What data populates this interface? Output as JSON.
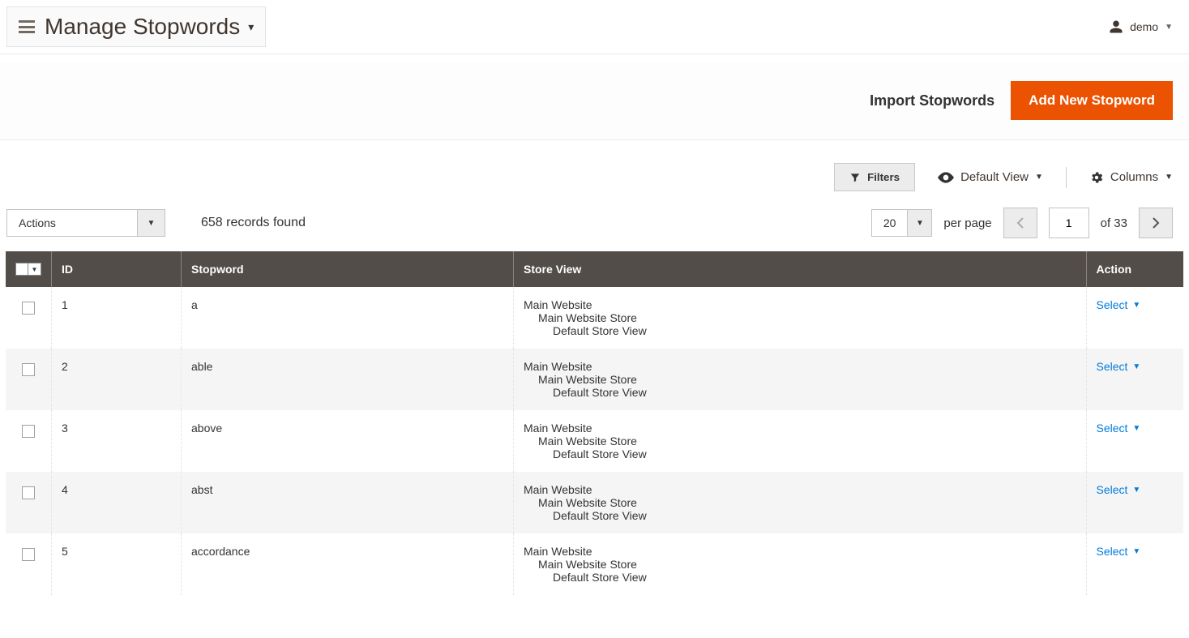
{
  "header": {
    "title": "Manage Stopwords",
    "user_label": "demo"
  },
  "actions": {
    "import_label": "Import Stopwords",
    "add_label": "Add New Stopword"
  },
  "toolbar": {
    "filters_label": "Filters",
    "default_view_label": "Default View",
    "columns_label": "Columns"
  },
  "controls": {
    "actions_dropdown_label": "Actions",
    "records_found": "658 records found",
    "per_page_value": "20",
    "per_page_label": "per page",
    "current_page": "1",
    "total_pages_label": "of 33"
  },
  "table": {
    "headers": {
      "id": "ID",
      "stopword": "Stopword",
      "store_view": "Store View",
      "action": "Action"
    },
    "store_view": {
      "l1": "Main Website",
      "l2": "Main Website Store",
      "l3": "Default Store View"
    },
    "action_label": "Select",
    "rows": [
      {
        "id": "1",
        "stopword": "a"
      },
      {
        "id": "2",
        "stopword": "able"
      },
      {
        "id": "3",
        "stopword": "above"
      },
      {
        "id": "4",
        "stopword": "abst"
      },
      {
        "id": "5",
        "stopword": "accordance"
      }
    ]
  }
}
